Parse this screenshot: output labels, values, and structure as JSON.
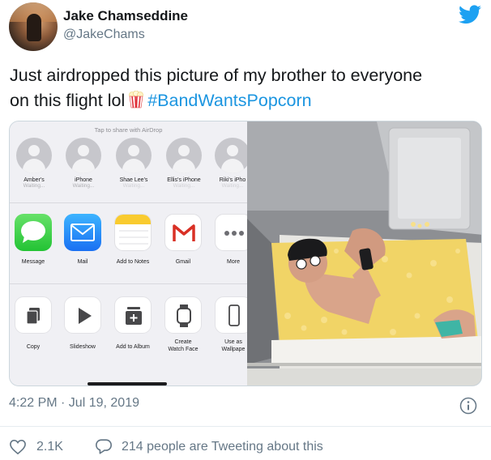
{
  "tweet": {
    "display_name": "Jake Chamseddine",
    "handle": "@JakeChams",
    "text_line1": "Just airdropped this picture of my brother to everyone",
    "text_line2_before": "on this flight lol",
    "hashtag": "#BandWantsPopcorn",
    "timestamp": "4:22 PM · Jul 19, 2019",
    "like_count": "2.1K",
    "tweeting_text": "214 people are Tweeting about this"
  },
  "share_sheet": {
    "airdrop_title": "Tap to share with AirDrop",
    "contacts": [
      {
        "name": "Amber's",
        "status": "Waiting..."
      },
      {
        "name": "iPhone",
        "status": "Waiting..."
      },
      {
        "name": "Shae Lee's",
        "status": "Waiting..."
      },
      {
        "name": "Ellis's iPhone",
        "status": "Waiting..."
      },
      {
        "name": "Riki's iPho",
        "status": "Waiting..."
      }
    ],
    "apps": [
      {
        "label": "Message",
        "icon": "messages-icon"
      },
      {
        "label": "Mail",
        "icon": "mail-icon"
      },
      {
        "label": "Add to Notes",
        "icon": "notes-icon"
      },
      {
        "label": "Gmail",
        "icon": "gmail-icon"
      },
      {
        "label": "More",
        "icon": "more-icon"
      }
    ],
    "actions": [
      {
        "label1": "Copy",
        "label2": "",
        "icon": "copy-icon"
      },
      {
        "label1": "Slideshow",
        "label2": "",
        "icon": "play-icon"
      },
      {
        "label1": "Add to Album",
        "label2": "",
        "icon": "add-album-icon"
      },
      {
        "label1": "Create",
        "label2": "Watch Face",
        "icon": "watch-icon"
      },
      {
        "label1": "Use as",
        "label2": "Wallpape",
        "icon": "phone-icon"
      }
    ]
  },
  "colors": {
    "hashtag": "#1b95e0",
    "twitter_blue": "#1da1f2",
    "secondary_text": "#657786",
    "popcorn": "#f4d35e"
  }
}
